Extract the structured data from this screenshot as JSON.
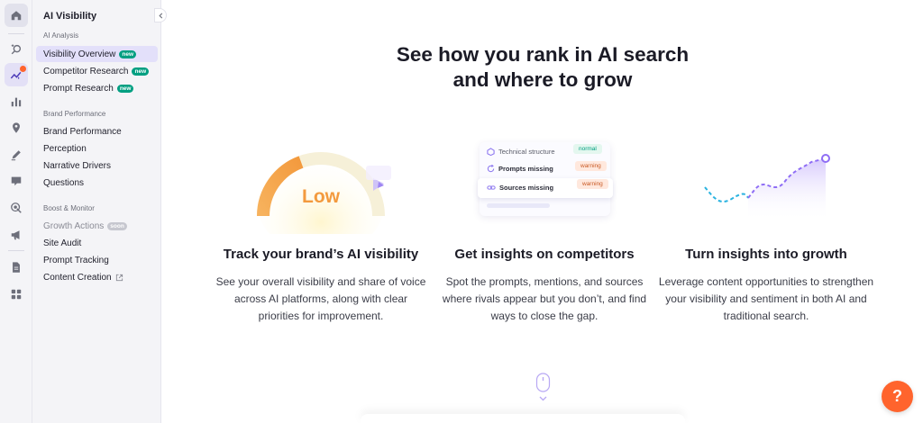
{
  "sidebar": {
    "title": "AI Visibility",
    "sections": [
      {
        "label": "AI Analysis",
        "items": [
          {
            "label": "Visibility Overview",
            "badge": "new"
          },
          {
            "label": "Competitor Research",
            "badge": "new"
          },
          {
            "label": "Prompt Research",
            "badge": "new"
          }
        ]
      },
      {
        "label": "Brand Performance",
        "items": [
          {
            "label": "Brand Performance"
          },
          {
            "label": "Perception"
          },
          {
            "label": "Narrative Drivers"
          },
          {
            "label": "Questions"
          }
        ]
      },
      {
        "label": "Boost & Monitor",
        "items": [
          {
            "label": "Growth Actions",
            "badge": "soon"
          },
          {
            "label": "Site Audit"
          },
          {
            "label": "Prompt Tracking"
          },
          {
            "label": "Content Creation"
          }
        ]
      }
    ]
  },
  "rail": {
    "icons": [
      "home-icon",
      "ai-search-icon",
      "trend-sparkle-icon",
      "bar-chart-icon",
      "location-pin-icon",
      "pencil-icon",
      "chat-bubble-icon",
      "target-cursor-icon",
      "megaphone-icon",
      "document-icon",
      "apps-grid-icon"
    ]
  },
  "main": {
    "headline_line1": "See how you rank in AI search",
    "headline_line2": "and where to grow",
    "cards": [
      {
        "title": "Track your brand’s AI visibility",
        "description": "See your overall visibility and share of voice across AI platforms, along with clear priorities for improvement.",
        "visual": {
          "gauge_label": "Low"
        }
      },
      {
        "title": "Get insights on competitors",
        "description": "Spot the prompts, mentions, and sources where rivals appear but you don’t, and find ways to close the gap.",
        "visual": {
          "rows": [
            {
              "label": "Technical structure",
              "status": "normal"
            },
            {
              "label": "Prompts missing",
              "status": "warning"
            },
            {
              "label": "Sources missing",
              "status": "warning"
            }
          ]
        }
      },
      {
        "title": "Turn insights into growth",
        "description": "Leverage content opportunities to strengthen your visibility and sentiment in both AI and traditional search."
      }
    ]
  },
  "help": {
    "label": "?"
  },
  "colors": {
    "accent": "#7d5ff5",
    "brand_orange": "#ff642d",
    "new_badge": "#009f81",
    "selected_bg": "#e3e0fa"
  }
}
